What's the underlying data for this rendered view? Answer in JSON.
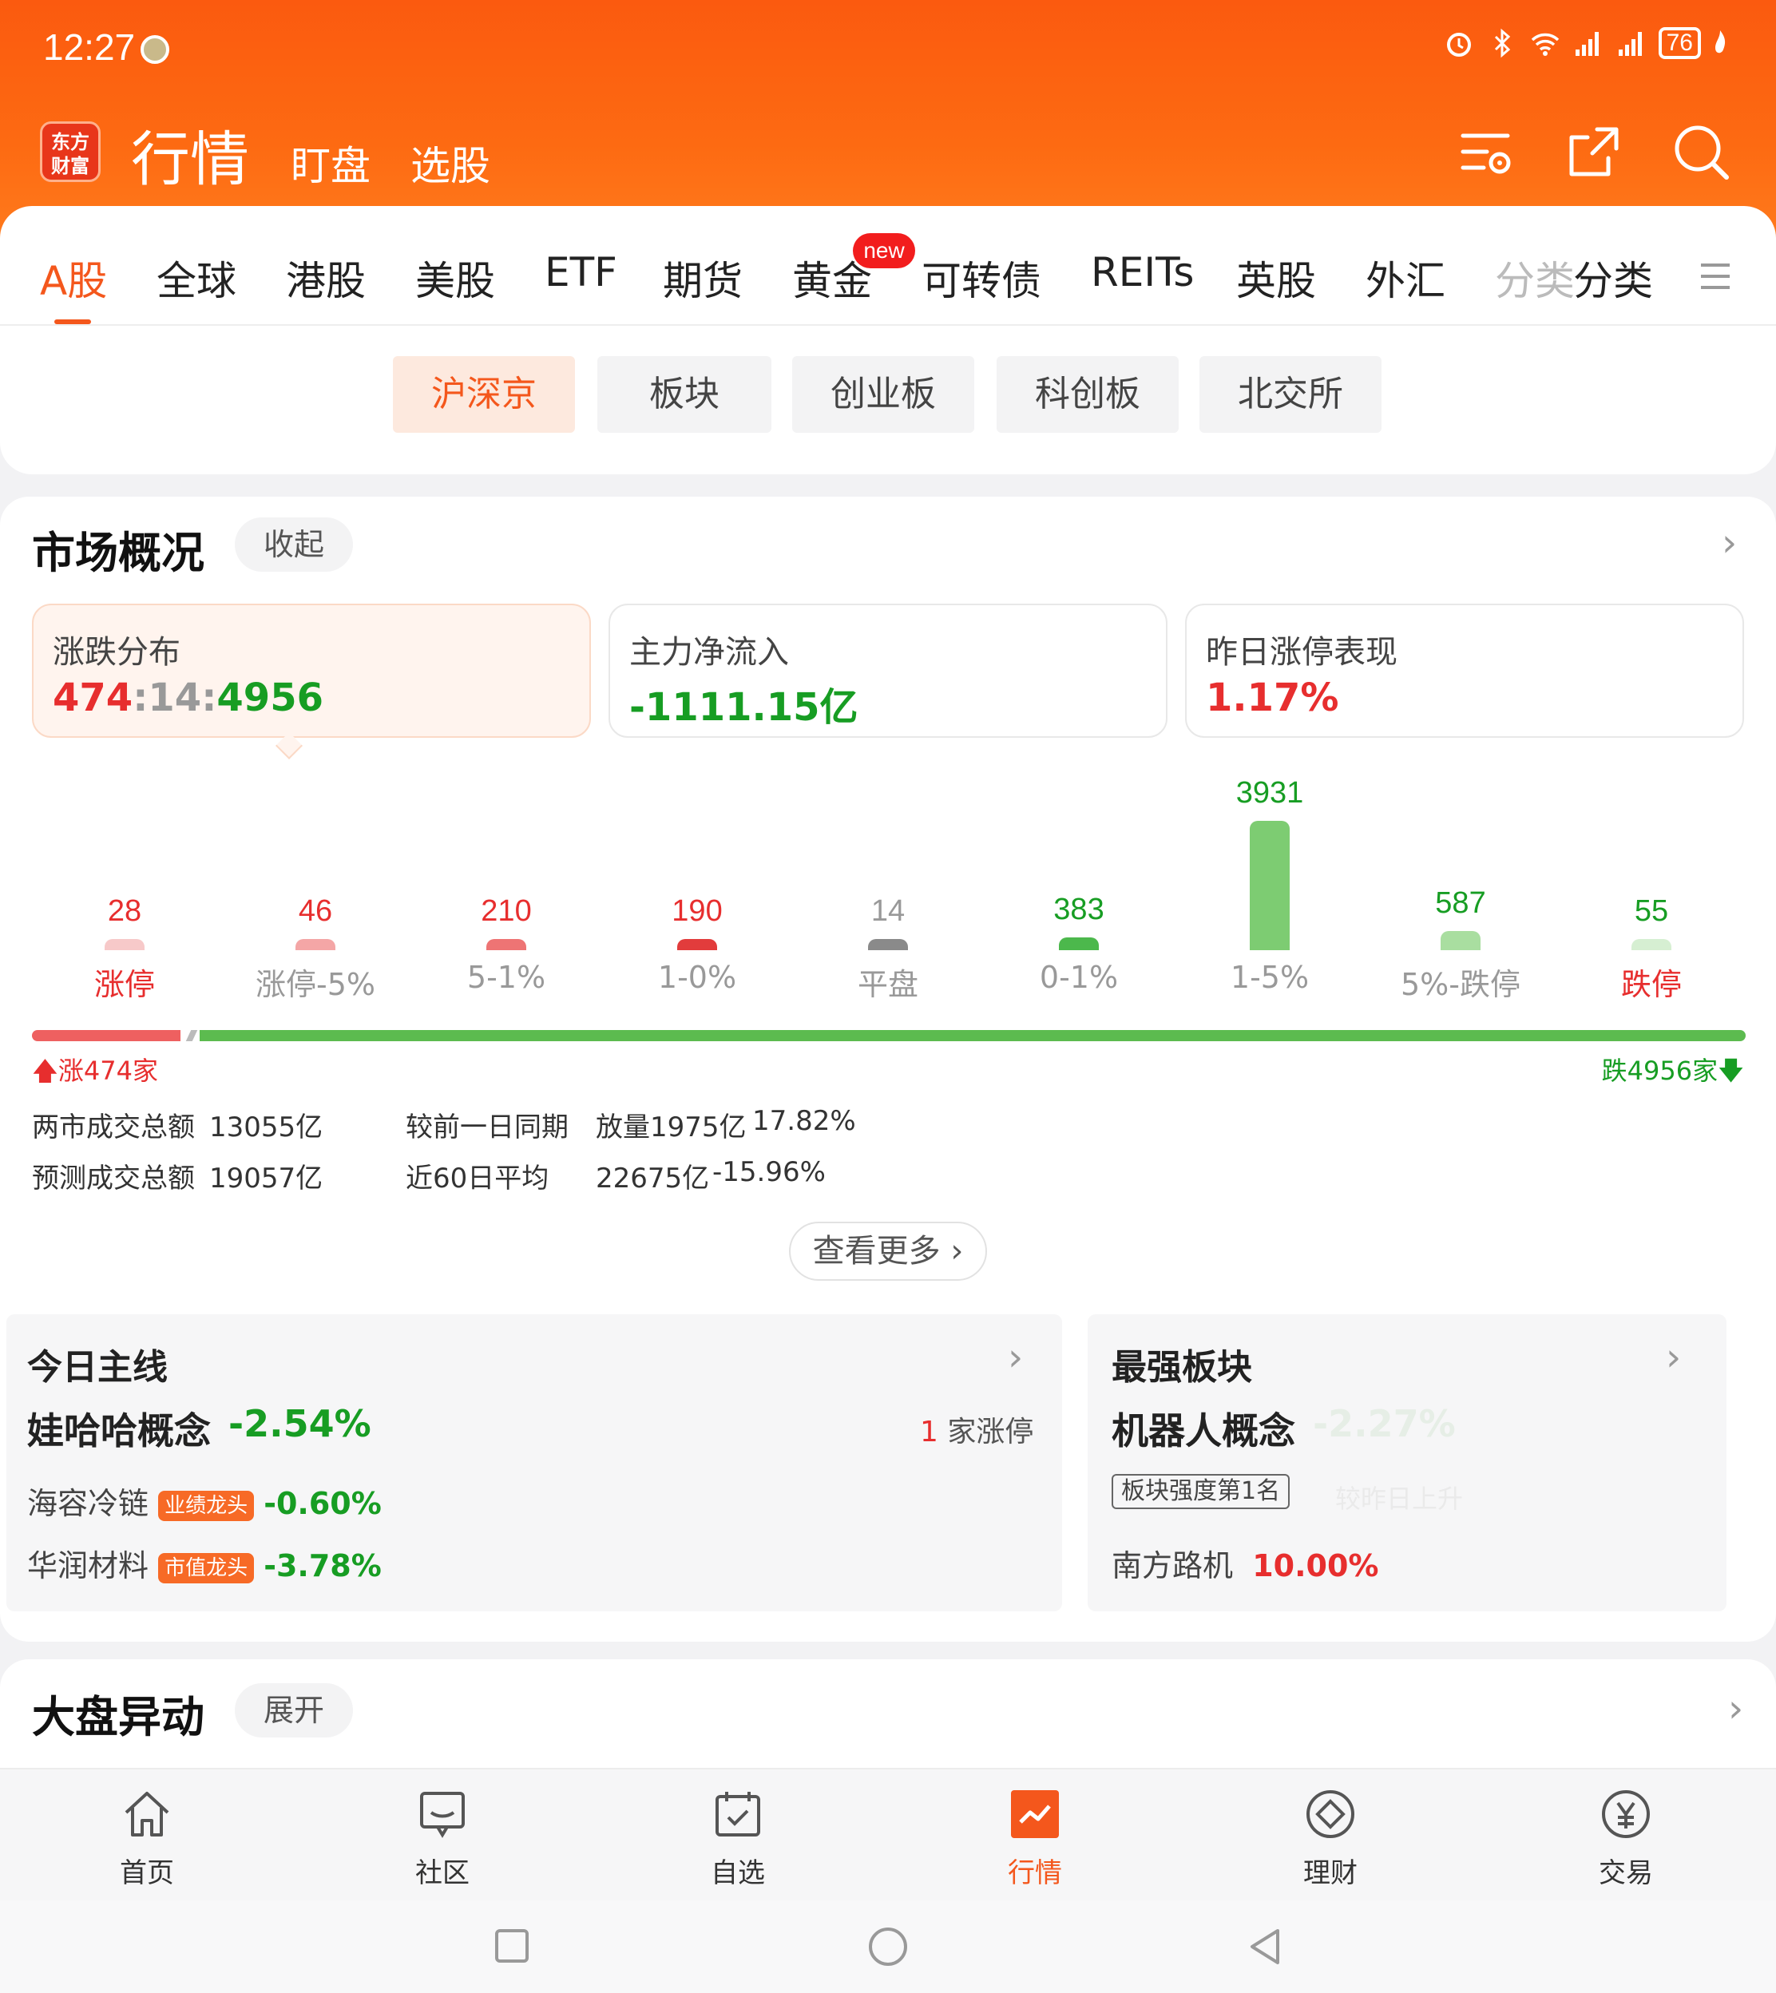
{
  "status_bar": {
    "time": "12:27",
    "battery": "76"
  },
  "header": {
    "logo": "东方\n财富",
    "title": "行情",
    "nav": [
      "盯盘",
      "选股"
    ]
  },
  "tabs": [
    "A股",
    "全球",
    "港股",
    "美股",
    "ETF",
    "期货",
    "黄金",
    "可转债",
    "REITs",
    "英股",
    "外汇",
    "分类",
    "分类"
  ],
  "tab_badge": "new",
  "sub_tabs": [
    "沪深京",
    "板块",
    "创业板",
    "科创板",
    "北交所"
  ],
  "market": {
    "title": "市场概况",
    "toggle": "收起",
    "cards": [
      {
        "label": "涨跌分布",
        "value_up": "474",
        "value_flat": "14",
        "value_down": "4956",
        "sep": ":"
      },
      {
        "label": "主力净流入",
        "value": "-1111.15亿"
      },
      {
        "label": "昨日涨停表现",
        "value": "1.17%"
      }
    ],
    "up_label": "涨474家",
    "down_label": "跌4956家",
    "stats": {
      "total_label": "两市成交总额",
      "total_value": "13055亿",
      "cmp_label": "较前一日同期",
      "cmp_value": "放量1975亿",
      "cmp_pct": "17.82%",
      "pred_label": "预测成交总额",
      "pred_value": "19057亿",
      "avg_label": "近60日平均",
      "avg_value": "22675亿",
      "avg_pct": "-15.96%"
    },
    "more": "查看更多"
  },
  "chart_data": {
    "type": "bar",
    "categories": [
      "涨停",
      "涨停-5%",
      "5-1%",
      "1-0%",
      "平盘",
      "0-1%",
      "1-5%",
      "5%-跌停",
      "跌停"
    ],
    "values": [
      28,
      46,
      210,
      190,
      14,
      383,
      3931,
      587,
      55
    ],
    "colors": [
      "#f7c9c9",
      "#f4a6a6",
      "#ee7474",
      "#e23c3c",
      "#8a8a8a",
      "#4cb84c",
      "#7dcc72",
      "#a9dea0",
      "#d6efd2"
    ],
    "label_colors": [
      "#e72e2e",
      "#e72e2e",
      "#e72e2e",
      "#e72e2e",
      "#999999",
      "#179d23",
      "#179d23",
      "#179d23",
      "#179d23"
    ],
    "xlabel_colors": [
      "#e72e2e",
      "#999999",
      "#999999",
      "#999999",
      "#999999",
      "#999999",
      "#999999",
      "#999999",
      "#e72e2e"
    ],
    "ylim": [
      0,
      3931
    ]
  },
  "mainline": {
    "title": "今日主线",
    "name": "娃哈哈概念",
    "pct": "-2.54%",
    "limit_count": "1",
    "limit_label": "家涨停",
    "stocks": [
      {
        "name": "海容冷链",
        "tag": "业绩龙头",
        "pct": "-0.60%"
      },
      {
        "name": "华润材料",
        "tag": "市值龙头",
        "pct": "-3.78%"
      }
    ]
  },
  "strongest": {
    "title": "最强板块",
    "name": "机器人概念",
    "pct": "-2.27%",
    "rank": "板块强度第1名",
    "rank_note": "较昨日上升",
    "stock": "南方路机",
    "stock_pct": "10.00%"
  },
  "anomaly": {
    "title": "大盘异动",
    "toggle": "展开"
  },
  "bottom_nav": [
    "首页",
    "社区",
    "自选",
    "行情",
    "理财",
    "交易"
  ]
}
